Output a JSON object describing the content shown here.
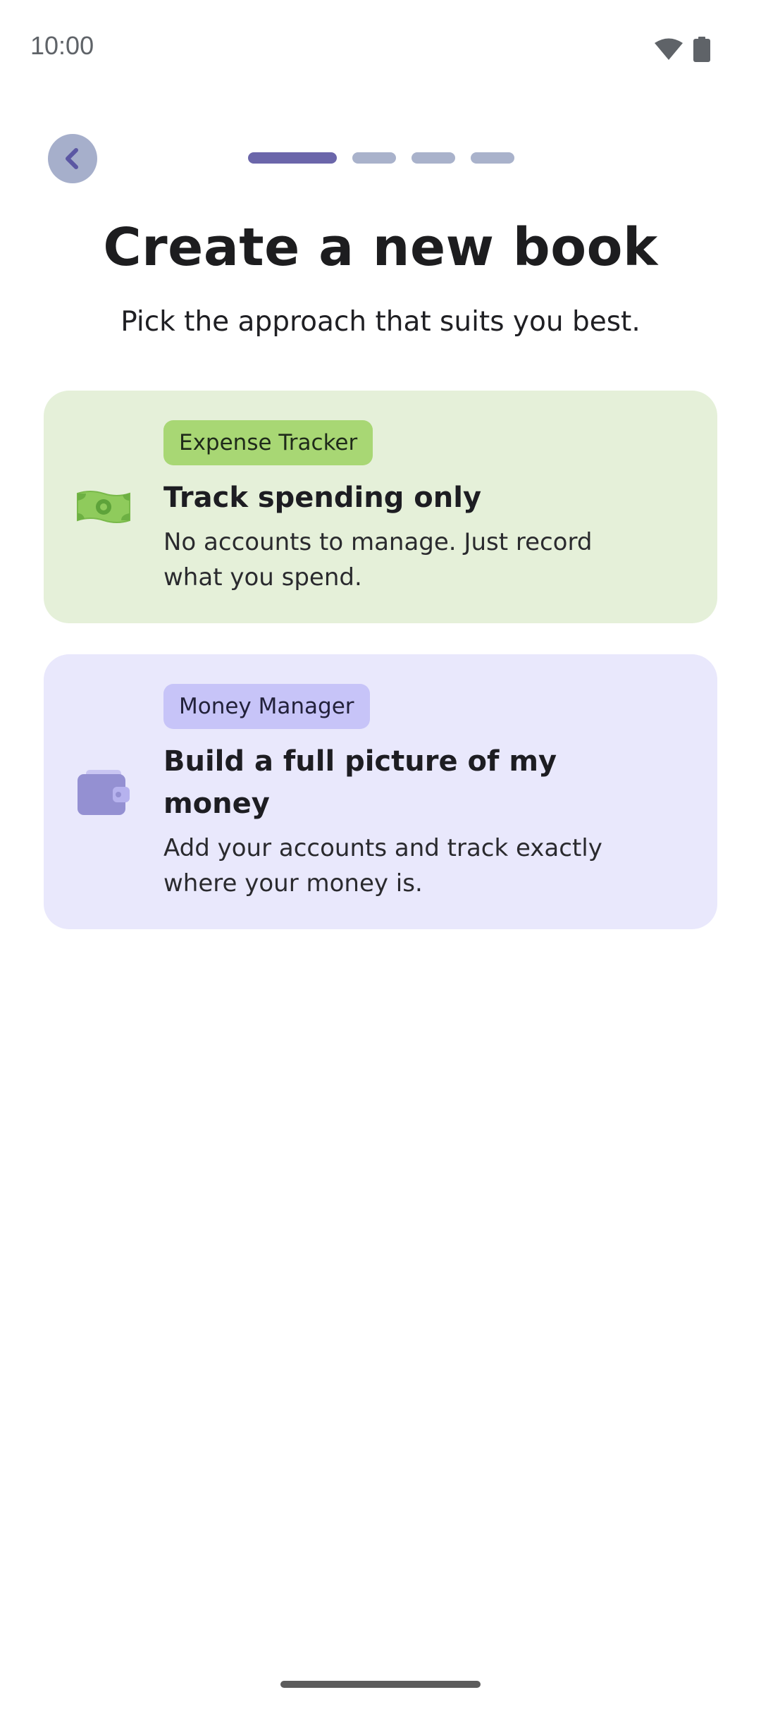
{
  "status_bar": {
    "time": "10:00",
    "icons": [
      "wifi-icon",
      "battery-icon"
    ],
    "icon_color": "#5f6368"
  },
  "header": {
    "back_icon": "chevron-left-icon",
    "progress": {
      "total_steps": 4,
      "current_step": 1
    },
    "colors": {
      "active": "#6b66aa",
      "inactive": "#a9b2cb",
      "back_bg": "#a6afcb"
    }
  },
  "page": {
    "title": "Create a new book",
    "subtitle": "Pick the approach that suits you best."
  },
  "options": [
    {
      "id": "expense",
      "icon": "cash-icon",
      "badge": "Expense Tracker",
      "title": "Track spending only",
      "description": "No accounts to manage. Just record what you spend.",
      "background": "#e5f0d9",
      "badge_color": "#a8d774"
    },
    {
      "id": "money",
      "icon": "wallet-icon",
      "badge": "Money Manager",
      "title": "Build a full picture of my money",
      "description": "Add your accounts and track exactly where your money is.",
      "background": "#e9e8fc",
      "badge_color": "#c7c4f8"
    }
  ]
}
